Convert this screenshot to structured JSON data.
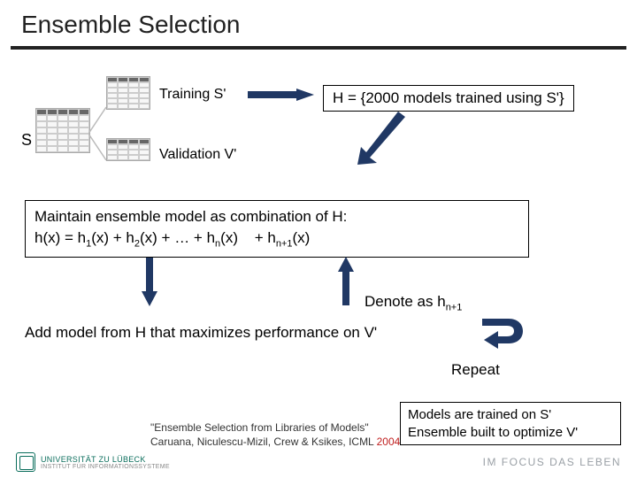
{
  "title": "Ensemble Selection",
  "labels": {
    "s": "S",
    "training": "Training S'",
    "validation": "Validation V'"
  },
  "boxes": {
    "h": "H = {2000 models trained using S'}",
    "ensemble_line1": "Maintain ensemble model as combination of H:",
    "ensemble_line2_prefix": "h(x) = h",
    "ensemble_line2_rest": "(x) + h",
    "ensemble_terms": [
      "1",
      "2"
    ],
    "ensemble_dots": "(x) + … + h",
    "ensemble_n": "n",
    "ensemble_tail": "(x)",
    "ensemble_extra_pre": "+ h",
    "ensemble_extra_sub": "n+1",
    "ensemble_extra_tail": "(x)",
    "models_line1": "Models are trained on S'",
    "models_line2": "Ensemble built to optimize V'"
  },
  "denote_pre": "Denote as h",
  "denote_sub": "n+1",
  "add_model": "Add model from H that maximizes performance on V'",
  "repeat": "Repeat",
  "citation": {
    "line1": "\"Ensemble Selection from Libraries of Models\"",
    "line2_pre": "Caruana, Niculescu-Mizil, Crew & Ksikes, ICML ",
    "year": "2004"
  },
  "footer": {
    "left_top": "UNIVERSITÄT ZU LÜBECK",
    "left_bottom": "INSTITUT FÜR INFORMATIONSSYSTEME",
    "right": "IM FOCUS DAS LEBEN"
  }
}
